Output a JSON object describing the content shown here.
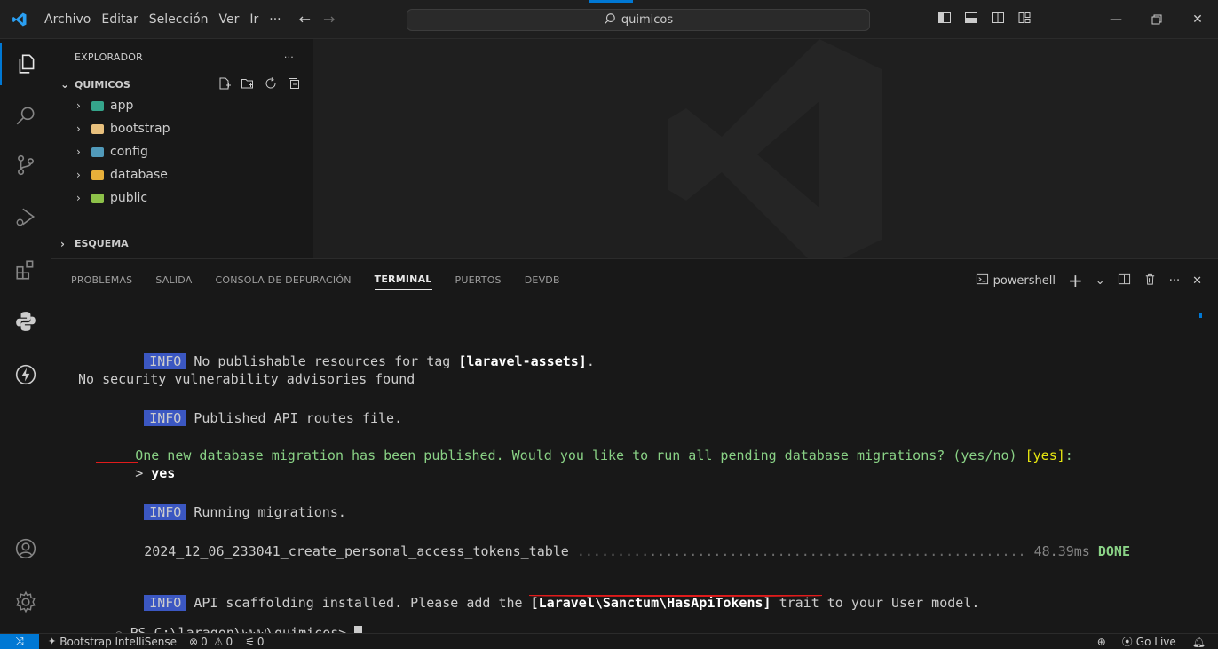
{
  "titlebar": {
    "menu": [
      "Archivo",
      "Editar",
      "Selección",
      "Ver",
      "Ir",
      "···"
    ],
    "search": "quimicos",
    "accent_color": "#0078d4"
  },
  "sidebar": {
    "title": "EXPLORADOR",
    "more": "···",
    "section": "QUIMICOS",
    "items": [
      {
        "label": "app",
        "color": "#4ec9b0"
      },
      {
        "label": "bootstrap",
        "color": "#e8c07d"
      },
      {
        "label": "config",
        "color": "#519aba"
      },
      {
        "label": "database",
        "color": "#e8c07d"
      },
      {
        "label": "public",
        "color": "#8dc149"
      }
    ],
    "outline_section": "ESQUEMA"
  },
  "panel": {
    "tabs": [
      "PROBLEMAS",
      "SALIDA",
      "CONSOLA DE DEPURACIÓN",
      "TERMINAL",
      "PUERTOS",
      "DEVDB"
    ],
    "active_tab": "TERMINAL",
    "shell": "powershell"
  },
  "terminal": {
    "badge": "INFO",
    "line1_text": "No publishable resources for tag ",
    "line1_tag": "[laravel-assets]",
    "line1_end": ".",
    "line2": "No security vulnerability advisories found",
    "line3": "Published API routes file.",
    "line4_text": "One new database migration has been published. Would you like to run all pending database migrations? (yes/no) ",
    "line4_default": "[yes]",
    "line4_end": ":",
    "line5_prompt": "> ",
    "line5_answer": "yes",
    "line6": "Running migrations.",
    "line7_migration": "2024_12_06_233041_create_personal_access_tokens_table",
    "line7_dots": " ........................................................ ",
    "line7_time": "48.39ms ",
    "line7_status": "DONE",
    "line8_text": "API scaffolding installed. Please add the ",
    "line8_trait": "[Laravel\\Sanctum\\HasApiTokens]",
    "line8_end": " trait to your User model.",
    "prompt_marker": "○",
    "prompt": "PS C:\\laragon\\www\\quimicos> "
  },
  "statusbar": {
    "extension": "Bootstrap IntelliSense",
    "errors": "0",
    "warnings": "0",
    "ports": "0",
    "golive": "Go Live"
  }
}
